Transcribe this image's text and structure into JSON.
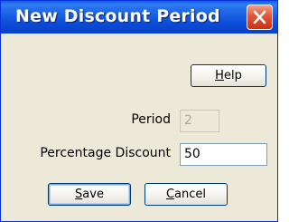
{
  "window": {
    "title": "New Discount Period"
  },
  "buttons": {
    "help": {
      "label": "Help",
      "mnemonic": "H",
      "rest": "elp"
    },
    "save": {
      "label": "Save",
      "mnemonic": "S",
      "rest": "ave"
    },
    "cancel": {
      "label": "Cancel",
      "mnemonic": "C",
      "rest": "ancel"
    }
  },
  "form": {
    "period": {
      "label": "Period",
      "value": "2",
      "enabled": false
    },
    "percentage_discount": {
      "label": "Percentage Discount",
      "value": "50",
      "enabled": true
    }
  },
  "icons": {
    "close": "close-icon"
  },
  "colors": {
    "titlebar": "#0b4bd8",
    "dialog_background": "#ece9d8",
    "close_button": "#e0573a"
  }
}
